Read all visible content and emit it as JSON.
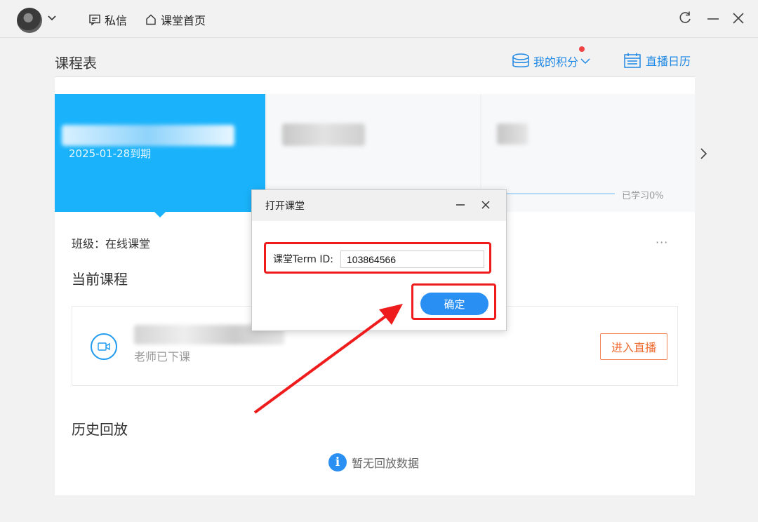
{
  "titlebar": {
    "messages_label": "私信",
    "home_label": "课堂首页"
  },
  "header": {
    "page_title": "课程表",
    "points_label": "我的积分",
    "calendar_label": "直播日历"
  },
  "cards": [
    {
      "due_text": "2025-01-28到期",
      "selected": true
    },
    {
      "selected": false
    },
    {
      "progress_text": "已学习0%",
      "selected": false
    }
  ],
  "course": {
    "class_label": "班级：在线课堂",
    "more_label": "···",
    "current_title": "当前课程",
    "teacher_status": "老师已下课",
    "enter_button": "进入直播",
    "history_title": "历史回放",
    "empty_text": "暂无回放数据",
    "info_glyph": "i"
  },
  "dialog": {
    "title": "打开课堂",
    "field_label": "课堂Term ID:",
    "field_value": "103864566",
    "ok_button": "确定"
  },
  "colors": {
    "accent": "#1ab3fb",
    "link": "#1e88e5",
    "button": "#2a8ff2",
    "highlight": "#ee1c1c",
    "enter_button": "#f06a30"
  },
  "icons": {
    "refresh": "refresh-icon",
    "minimize": "minimize-icon",
    "close": "close-icon",
    "camera": "video-camera-icon",
    "info": "info-icon"
  }
}
